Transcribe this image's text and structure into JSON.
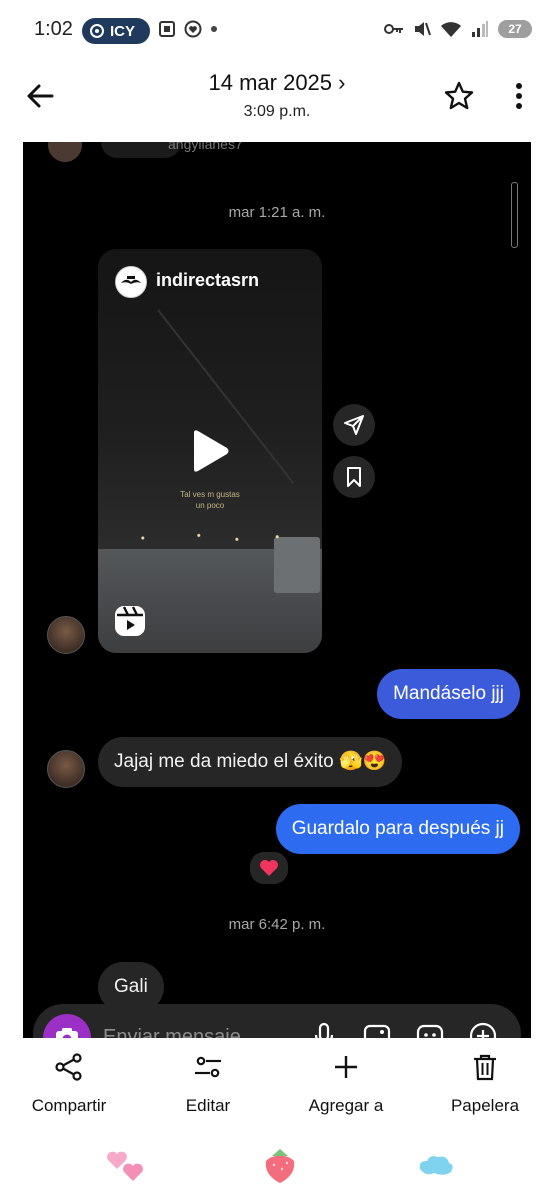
{
  "status_bar": {
    "time": "1:02",
    "pill_label": "ICY",
    "battery": "27"
  },
  "header": {
    "date": "14 mar 2025",
    "date_chevron": "›",
    "time": "3:09 p.m."
  },
  "chat": {
    "cut_username": "angyllanes7",
    "timestamp_1": "mar 1:21 a. m.",
    "reel": {
      "username": "indirectasrn",
      "caption": "Tal ves m gustas\nun poco"
    },
    "messages": [
      {
        "side": "out",
        "text": "Mandáselo jjj"
      },
      {
        "side": "in",
        "text": "Jajaj me da miedo el éxito 🫣😍"
      },
      {
        "side": "out",
        "text": "Guardalo para después jj"
      }
    ],
    "reaction": "❤️",
    "timestamp_2": "mar 6:42 p. m.",
    "last_message": "Gali",
    "composer_placeholder": "Enviar mensaje..."
  },
  "actions": [
    {
      "label": "Compartir",
      "icon": "share-icon"
    },
    {
      "label": "Editar",
      "icon": "edit-sliders-icon"
    },
    {
      "label": "Agregar a",
      "icon": "plus-icon"
    },
    {
      "label": "Papelera",
      "icon": "trash-icon"
    }
  ],
  "colors": {
    "outgoing_bubble": "#3b5bdb",
    "incoming_bubble": "#262626",
    "camera_button": "#9b2fc6"
  }
}
